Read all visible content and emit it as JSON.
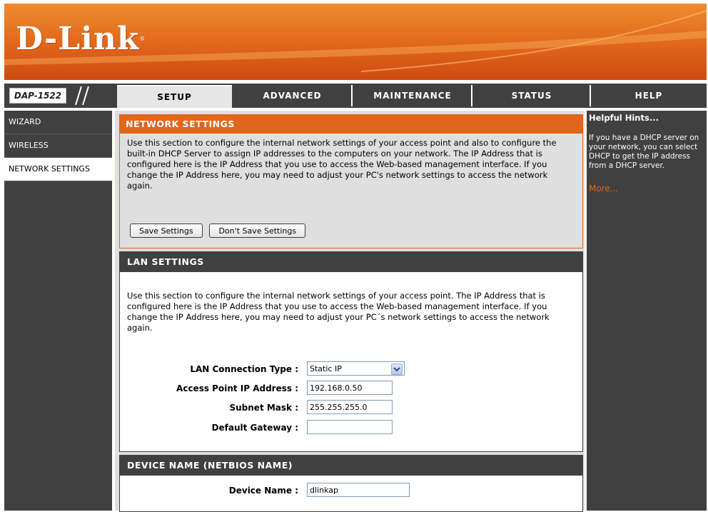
{
  "brand": {
    "logo": "D-Link",
    "model": "DAP-1522"
  },
  "nav": {
    "tabs": [
      {
        "label": "SETUP"
      },
      {
        "label": "ADVANCED"
      },
      {
        "label": "MAINTENANCE"
      },
      {
        "label": "STATUS"
      },
      {
        "label": "HELP"
      }
    ]
  },
  "sidebar": {
    "items": [
      {
        "label": "WIZARD"
      },
      {
        "label": "WIRELESS"
      },
      {
        "label": "NETWORK SETTINGS"
      }
    ]
  },
  "network_settings": {
    "title": "NETWORK SETTINGS",
    "description": "Use this section to configure the internal network settings of your access point and also to configure the built-in DHCP Server to assign IP addresses to the computers on your network. The IP Address that is configured here is the IP Address that you use to access the Web-based management interface. If you change the IP Address here, you may need to adjust your PC's network settings to access the network again.",
    "save_label": "Save Settings",
    "dont_save_label": "Don't Save Settings"
  },
  "lan_settings": {
    "title": "LAN SETTINGS",
    "description": "Use this section to configure the internal network settings of your access point. The IP Address that is configured here is the IP Address that you use to access the Web-based management interface. If you change the IP Address here, you may need to adjust your PC´s network settings to access the network again.",
    "connection_type_label": "LAN Connection Type :",
    "connection_type_value": "Static IP",
    "ip_label": "Access Point IP Address :",
    "ip_value": "192.168.0.50",
    "mask_label": "Subnet Mask :",
    "mask_value": "255.255.255.0",
    "gateway_label": "Default Gateway :",
    "gateway_value": ""
  },
  "device_name": {
    "title": "DEVICE NAME (NETBIOS NAME)",
    "label": "Device Name :",
    "value": "dlinkap"
  },
  "help": {
    "title": "Helpful Hints...",
    "text": "If you have a DHCP server on your network, you can select DHCP to get the IP address from a DHCP server.",
    "more": "More..."
  },
  "colors": {
    "accent": "#e0661b",
    "dark": "#404040",
    "panel_bg": "#dfdfdf"
  }
}
